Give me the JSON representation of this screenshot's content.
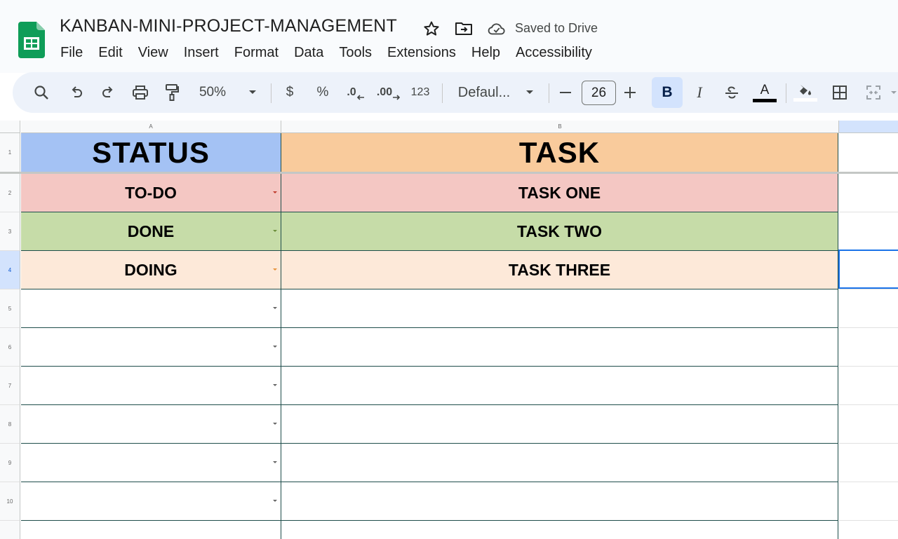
{
  "document": {
    "title": "KANBAN-MINI-PROJECT-MANAGEMENT",
    "save_status": "Saved to Drive"
  },
  "menu": [
    "File",
    "Edit",
    "View",
    "Insert",
    "Format",
    "Data",
    "Tools",
    "Extensions",
    "Help",
    "Accessibility"
  ],
  "toolbar": {
    "zoom": "50%",
    "currency": "$",
    "percent": "%",
    "decrease_decimal": ".0",
    "increase_decimal": ".00",
    "number_format": "123",
    "font": "Defaul...",
    "font_size": "26",
    "bold": "B",
    "italic": "I",
    "text_color_letter": "A",
    "text_color": "#000000"
  },
  "sheet": {
    "columns": [
      "A",
      "B"
    ],
    "row_numbers": [
      "1",
      "2",
      "3",
      "4",
      "5",
      "6",
      "7",
      "8",
      "9",
      "10"
    ],
    "header": {
      "status": "STATUS",
      "task": "TASK"
    },
    "rows": [
      {
        "status": "TO-DO",
        "task": "TASK ONE"
      },
      {
        "status": "DONE",
        "task": "TASK TWO"
      },
      {
        "status": "DOING",
        "task": "TASK THREE"
      }
    ],
    "colors": {
      "status_header": "#a4c2f4",
      "task_header": "#f9cb9c",
      "todo": "#f4c7c3",
      "done": "#c6dca8",
      "doing": "#fde9d9",
      "selection": "#1a73e8"
    }
  }
}
